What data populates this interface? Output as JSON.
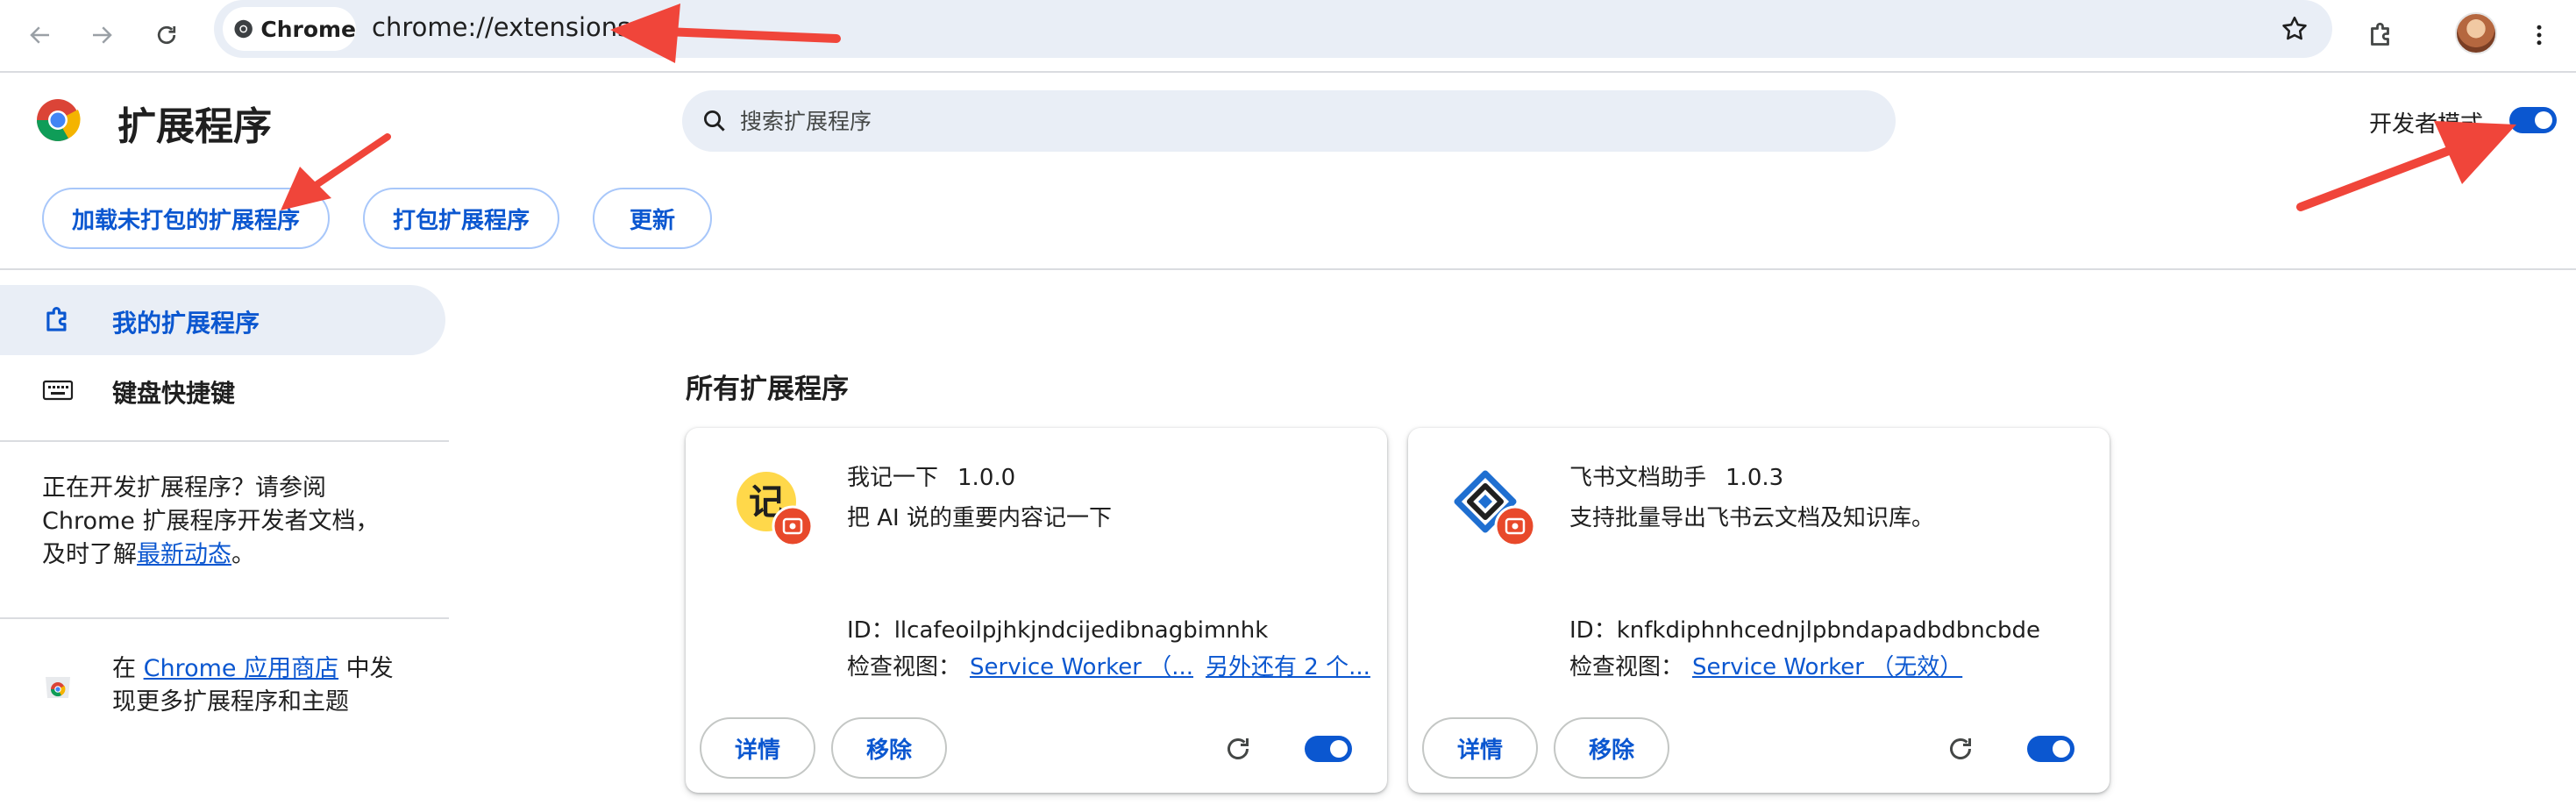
{
  "browser": {
    "chip_label": "Chrome",
    "url": "chrome://extensions"
  },
  "header": {
    "title": "扩展程序",
    "search_placeholder": "搜索扩展程序",
    "dev_mode_label": "开发者模式",
    "dev_mode_on": true,
    "buttons": {
      "load_unpacked": "加载未打包的扩展程序",
      "pack": "打包扩展程序",
      "update": "更新"
    }
  },
  "sidebar": {
    "items": [
      {
        "label": "我的扩展程序",
        "icon": "extensions-icon",
        "active": true
      },
      {
        "label": "键盘快捷键",
        "icon": "keyboard-icon",
        "active": false
      }
    ],
    "dev_note": {
      "line1": "正在开发扩展程序？请参阅",
      "line2": "Chrome 扩展程序开发者文档，",
      "line3_prefix": "及时了解",
      "line3_link": "最新动态",
      "line3_suffix": "。"
    },
    "store_note": {
      "prefix": "在 ",
      "link": "Chrome 应用商店",
      "suffix": " 中发",
      "line2": "现更多扩展程序和主题"
    }
  },
  "main": {
    "section_title": "所有扩展程序",
    "extensions": [
      {
        "name": "我记一下",
        "version": "1.0.0",
        "description": "把 AI 说的重要内容记一下",
        "id_label": "ID：",
        "id": "llcafeoilpjhkjndcijedibnagbimnhk",
        "views_label": "检查视图：",
        "view_link_1": "Service Worker （...",
        "view_link_2": "另外还有 2 个...",
        "details_label": "详情",
        "remove_label": "移除",
        "enabled": true
      },
      {
        "name": "飞书文档助手",
        "version": "1.0.3",
        "description": "支持批量导出飞书云文档及知识库。",
        "id_label": "ID：",
        "id": "knfkdiphnhcednjlpbndapadbdbncbde",
        "views_label": "检查视图：",
        "view_link_1": "Service Worker （无效）",
        "details_label": "详情",
        "remove_label": "移除",
        "enabled": true
      }
    ]
  },
  "colors": {
    "accent": "#0b57d0",
    "annotation_arrow": "#f0453a"
  }
}
